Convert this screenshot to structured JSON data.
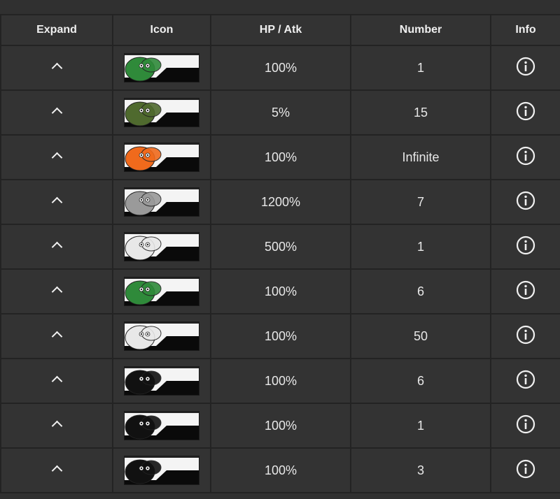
{
  "table": {
    "headers": {
      "expand": "Expand",
      "icon": "Icon",
      "hp_atk": "HP / Atk",
      "number": "Number",
      "info": "Info"
    },
    "rows": [
      {
        "icon": "green-spiky-beast-icon",
        "icon_color": "#2f8a3a",
        "hp_atk": "100%",
        "number": "1"
      },
      {
        "icon": "green-white-hybrid-creature-icon",
        "icon_color": "#4f6a2e",
        "hp_atk": "5%",
        "number": "15"
      },
      {
        "icon": "orange-fox-tail-icon",
        "icon_color": "#f06a1c",
        "hp_atk": "100%",
        "number": "Infinite"
      },
      {
        "icon": "grey-owl-icon",
        "icon_color": "#9a9a9a",
        "hp_atk": "1200%",
        "number": "7"
      },
      {
        "icon": "white-seal-icon",
        "icon_color": "#e8e8e8",
        "hp_atk": "500%",
        "number": "1"
      },
      {
        "icon": "green-spiky-beast-icon",
        "icon_color": "#2f8a3a",
        "hp_atk": "100%",
        "number": "6"
      },
      {
        "icon": "white-crocodile-icon",
        "icon_color": "#e8e8e8",
        "hp_atk": "100%",
        "number": "50"
      },
      {
        "icon": "black-gorilla-icon",
        "icon_color": "#111111",
        "hp_atk": "100%",
        "number": "6"
      },
      {
        "icon": "black-gorilla-icon",
        "icon_color": "#111111",
        "hp_atk": "100%",
        "number": "1"
      },
      {
        "icon": "black-gorilla-icon",
        "icon_color": "#111111",
        "hp_atk": "100%",
        "number": "3"
      }
    ]
  },
  "colors": {
    "background": "#303030",
    "cell": "#333333",
    "grid": "#232323",
    "text": "#e8e8e8"
  }
}
